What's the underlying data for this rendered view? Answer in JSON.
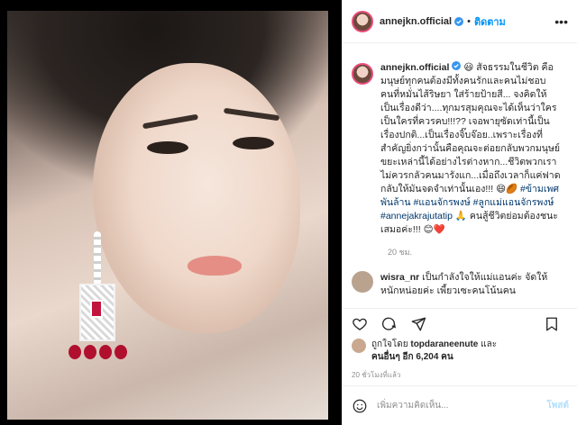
{
  "header": {
    "handle": "annejkn.official",
    "separator": "•",
    "follow_label": "ติดตาม",
    "more_icon": "more-icon"
  },
  "caption": {
    "handle": "annejkn.official",
    "text_1": " สัจธรรมในชีวิต คือ มนุษย์ทุกคนต้องมีทั้งคนรักและคนไม่ชอบ คนที่หมั่นไส้ริษยา ใส่ร้ายป้ายสี... จงคิดให้เป็นเรื่องดีว่า....ทุกมรสุมคุณจะได้เห็นว่าใครเป็นใครที่ควรคบ!!!?? เจอพายุซัดเท่านี้เป็นเรื่องปกติ...เป็นเรื่องจิ๊บจ๊อย..เพราะเรื่องที่สำคัญยิ่งกว่านั้นคือคุณจะต่อยกลับพวกมนุษย์ขยะเหล่านี้ได้อย่างไรต่างหาก...ชีวิตพวกเราไม่ควรกลัวคนมารังแก...เมื่อถึงเวลาก็แค่ฟาดกลับให้มันจดจำเท่านั้นเอง!!! ",
    "hashtag_1": "#ข้ามเพศพันล้าน",
    "hashtag_2": "#แอนจักรพงษ์",
    "hashtag_3": "#ลูกแม่แอนจักรพงษ์",
    "hashtag_4": "#annejakrajutatip",
    "text_2": " คนสู้ชีวิตย่อมต้องชนะเสมอค่ะ!!! ",
    "time": "20 ชม."
  },
  "comment": {
    "handle": "wisra_nr",
    "text": " เป็นกำลังใจให้แม่แอนค่ะ จัดให้หนักหน่อยค่ะ เพี้ยวเซะคนโน้นคน"
  },
  "likes": {
    "prefix": "ถูกใจโดย ",
    "user": "topdaraneenute",
    "middle": " และ",
    "others": "คนอื่นๆ อีก 6,204 คน"
  },
  "posted_ago": "20 ชั่วโมงที่แล้ว",
  "add_comment": {
    "placeholder": "เพิ่มความคิดเห็น...",
    "post_label": "โพสต์"
  },
  "colors": {
    "accent": "#0095f6",
    "link": "#00376b",
    "muted": "#8e8e8e",
    "verified": "#3897f0"
  }
}
